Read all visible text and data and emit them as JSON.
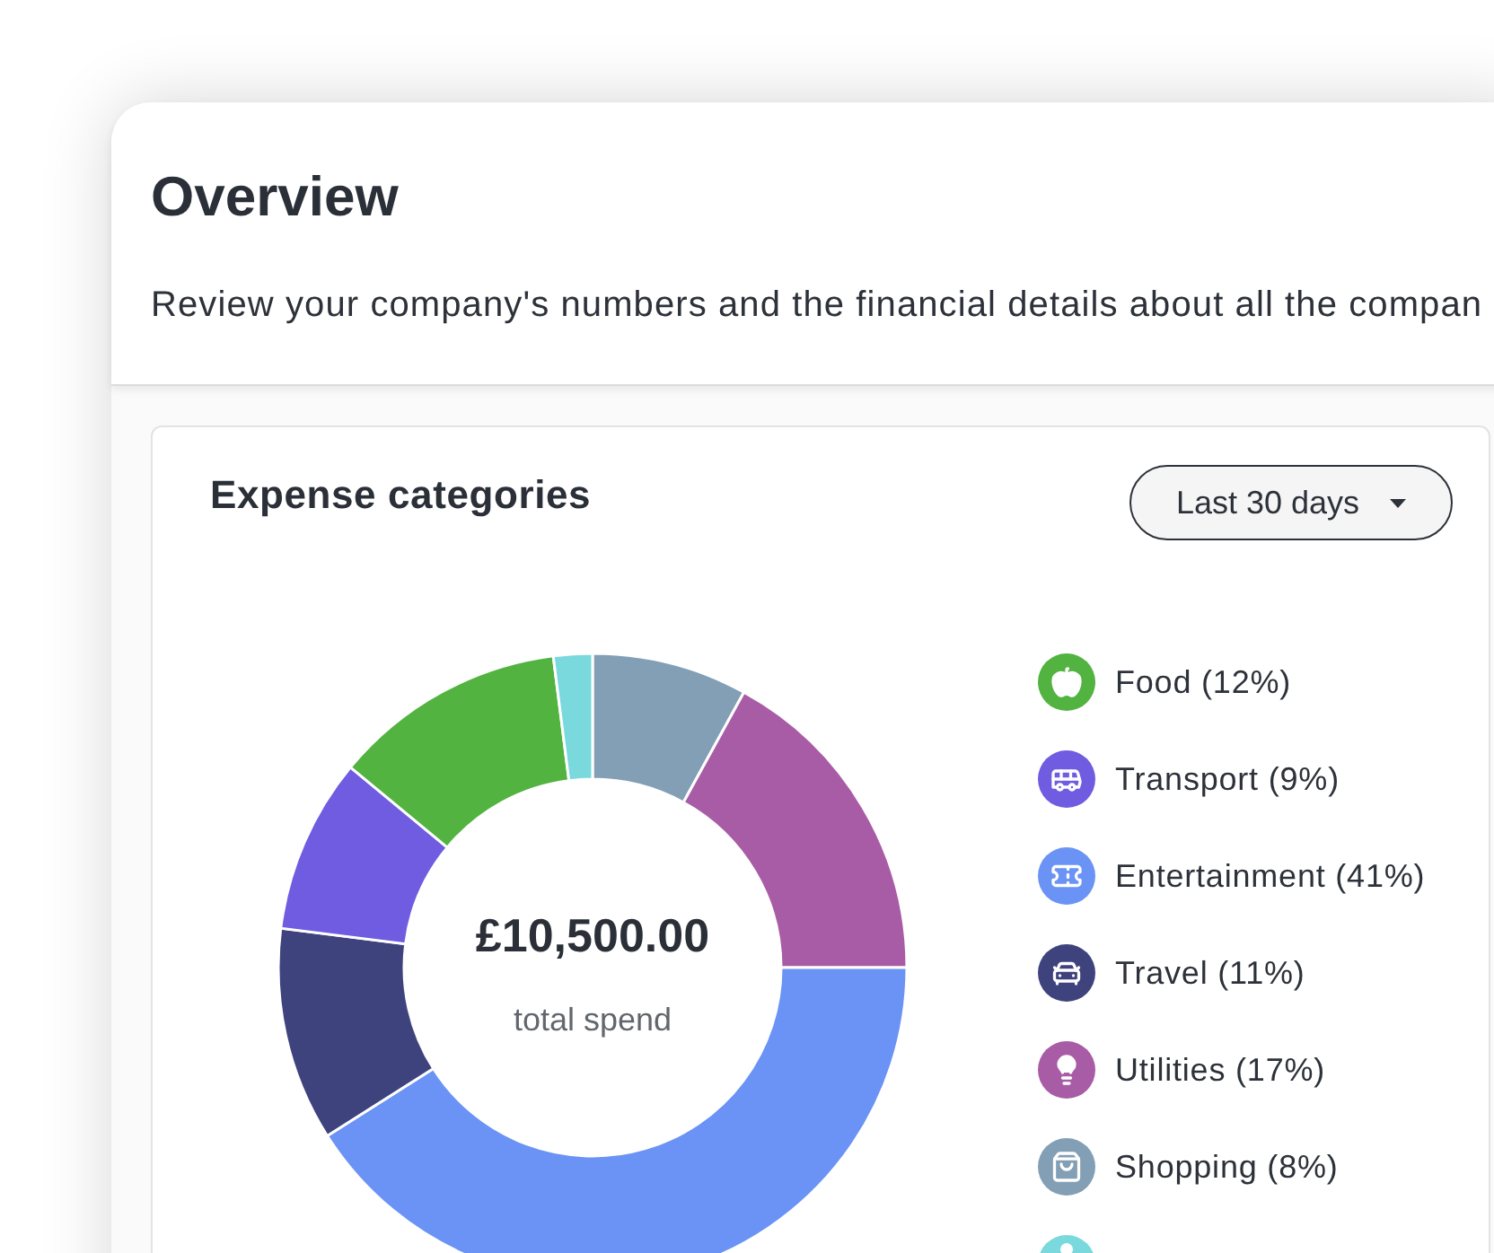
{
  "header": {
    "title": "Overview",
    "subtitle": "Review your company's numbers and the financial details about all the compan"
  },
  "expense_card": {
    "title": "Expense categories",
    "period_dropdown": {
      "value": "Last 30 days"
    },
    "chart_data": {
      "type": "donut",
      "values": [
        8,
        17,
        41,
        11,
        9,
        12,
        2
      ],
      "colors": [
        "#829fb5",
        "#a85ca6",
        "#6a93f5",
        "#3e437e",
        "#6f5ce0",
        "#52b340",
        "#79d9dc"
      ]
    },
    "center_total": "£10,500.00",
    "center_caption": "total spend",
    "legend": [
      {
        "kind": "food",
        "label": "Food (12%)",
        "color": "#52b340"
      },
      {
        "kind": "transport",
        "label": "Transport (9%)",
        "color": "#6f5ce0"
      },
      {
        "kind": "entertainment",
        "label": "Entertainment (41%)",
        "color": "#6a93f5"
      },
      {
        "kind": "travel",
        "label": "Travel (11%)",
        "color": "#3e437e"
      },
      {
        "kind": "utilities",
        "label": "Utilities (17%)",
        "color": "#a85ca6"
      },
      {
        "kind": "shopping",
        "label": "Shopping (8%)",
        "color": "#829fb5"
      },
      {
        "kind": "other",
        "color": "#79d9dc"
      }
    ]
  }
}
